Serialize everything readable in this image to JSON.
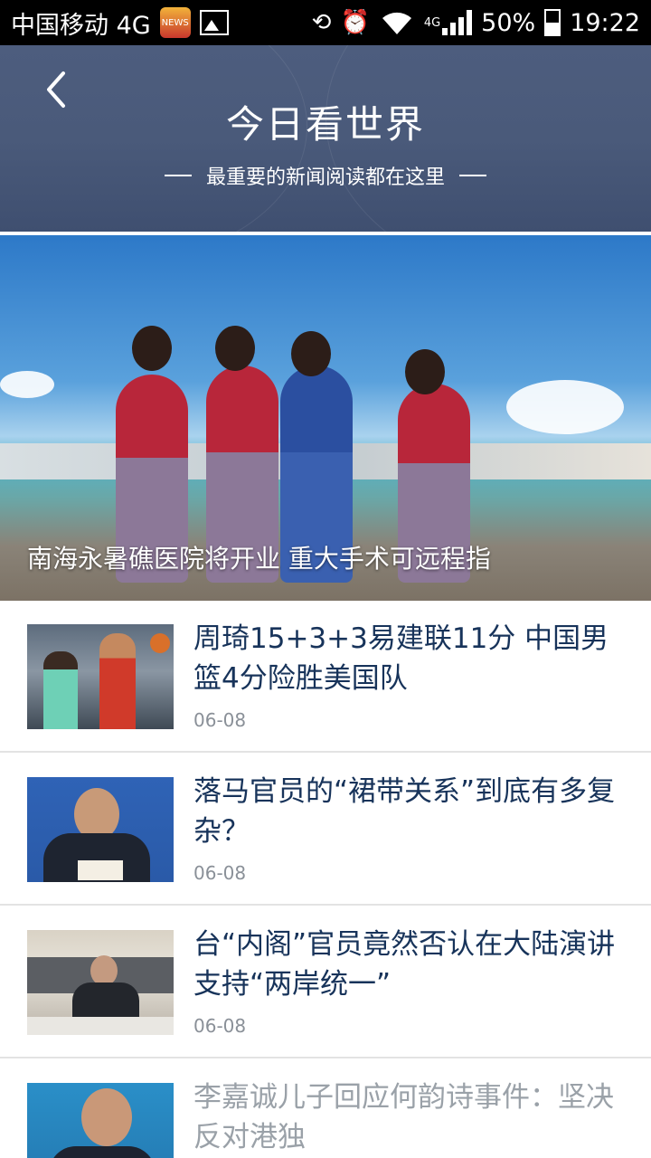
{
  "status_bar": {
    "carrier": "中国移动 4G",
    "app_badge": "NEWS",
    "network": "4G",
    "battery": "50%",
    "time": "19:22"
  },
  "header": {
    "title": "今日看世界",
    "subtitle": "最重要的新闻阅读都在这里"
  },
  "hero": {
    "caption": "南海永暑礁医院将开业 重大手术可远程指"
  },
  "news": [
    {
      "title": "周琦15+3+3易建联11分 中国男篮4分险胜美国队",
      "date": "06-08",
      "read": false
    },
    {
      "title": "落马官员的“裙带关系”到底有多复杂？",
      "date": "06-08",
      "read": false
    },
    {
      "title": "台“内阁”官员竟然否认在大陆演讲支持“两岸统一”",
      "date": "06-08",
      "read": false
    },
    {
      "title": "李嘉诚儿子回应何韵诗事件：坚决反对港独",
      "date": "",
      "read": true
    }
  ],
  "colors": {
    "header_bg": "#4a5a7a",
    "title_unread": "#17335a",
    "title_read": "#9aa1a8",
    "date": "#8a9098"
  }
}
